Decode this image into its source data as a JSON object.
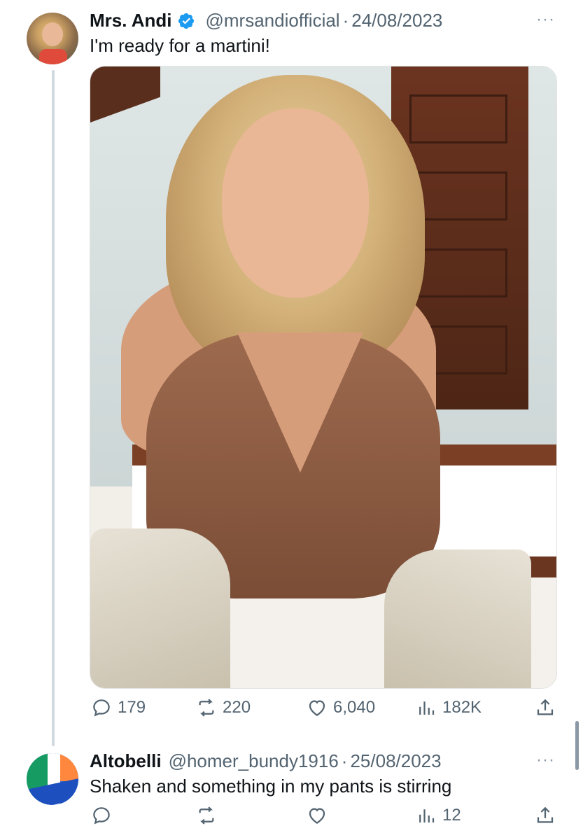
{
  "tweets": [
    {
      "name": "Mrs. Andi",
      "handle": "@mrsandiofficial",
      "separator": "·",
      "date": "24/08/2023",
      "text": "I'm ready for a martini!",
      "verified": true,
      "stats": {
        "replies": "179",
        "retweets": "220",
        "likes": "6,040",
        "views": "182K"
      }
    },
    {
      "name": "Altobelli",
      "handle": "@homer_bundy1916",
      "separator": "·",
      "date": "25/08/2023",
      "text": "Shaken and something in my pants is stirring",
      "verified": false,
      "stats": {
        "replies": "",
        "retweets": "",
        "likes": "",
        "views": "12"
      }
    }
  ],
  "more_label": "···",
  "colors": {
    "verified": "#1d9bf0",
    "muted": "#536471",
    "thread_line": "#cfd9de"
  }
}
